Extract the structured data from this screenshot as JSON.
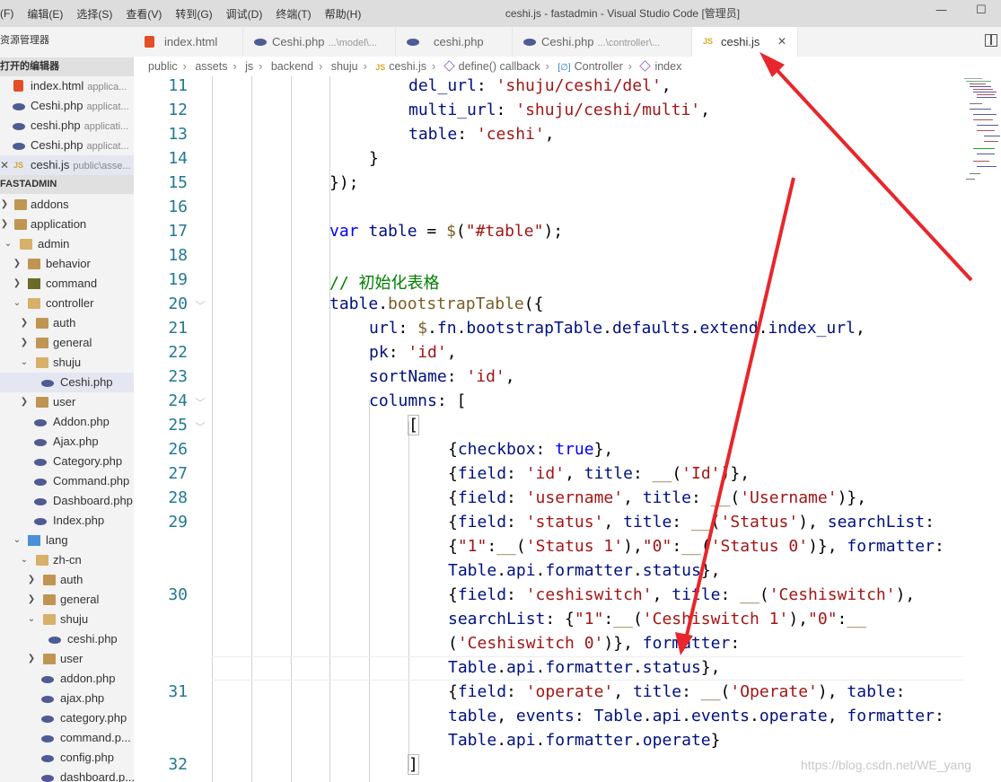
{
  "titlebar": {
    "menu": [
      "(F)",
      "编辑(E)",
      "选择(S)",
      "查看(V)",
      "转到(G)",
      "调试(D)",
      "终端(T)",
      "帮助(H)"
    ],
    "title": "ceshi.js - fastadmin - Visual Studio Code [管理员]"
  },
  "sidebar": {
    "header": "资源管理器",
    "open_editors_title": "打开的编辑器",
    "open_editors": [
      {
        "label": "index.html",
        "desc": "applica..."
      },
      {
        "label": "Ceshi.php",
        "desc": "applicat..."
      },
      {
        "label": "ceshi.php",
        "desc": "applicati..."
      },
      {
        "label": "Ceshi.php",
        "desc": "applicat..."
      },
      {
        "label": "ceshi.js",
        "desc": "public\\asse..."
      }
    ],
    "project_title": "FASTADMIN",
    "tree": [
      "addons",
      "application",
      "admin",
      "behavior",
      "command",
      "controller",
      "auth",
      "general",
      "shuju",
      "Ceshi.php",
      "user",
      "Addon.php",
      "Ajax.php",
      "Category.php",
      "Command.php",
      "Dashboard.php",
      "Index.php",
      "lang",
      "zh-cn",
      "auth",
      "general",
      "shuju",
      "ceshi.php",
      "user",
      "addon.php",
      "ajax.php",
      "category.php",
      "command.p...",
      "config.php",
      "dashboard.p..."
    ]
  },
  "tabs": [
    {
      "label": "index.html",
      "desc": ""
    },
    {
      "label": "Ceshi.php",
      "desc": "...\\model\\..."
    },
    {
      "label": "ceshi.php",
      "desc": ""
    },
    {
      "label": "Ceshi.php",
      "desc": "...\\controller\\..."
    },
    {
      "label": "ceshi.js",
      "desc": "",
      "close": "✕"
    }
  ],
  "breadcrumb": [
    "public",
    "assets",
    "js",
    "backend",
    "shuju",
    "ceshi.js",
    "define() callback",
    "Controller",
    "index"
  ],
  "line_numbers": [
    "11",
    "12",
    "13",
    "14",
    "15",
    "16",
    "17",
    "18",
    "19",
    "20",
    "21",
    "22",
    "23",
    "24",
    "25",
    "26",
    "27",
    "28",
    "29",
    "30",
    "31",
    "32"
  ],
  "code": {
    "l11": [
      "del_url",
      ": ",
      "'shuju/ceshi/del'",
      ","
    ],
    "l12": [
      "multi_url",
      ": ",
      "'shuju/ceshi/multi'",
      ","
    ],
    "l13": [
      "table",
      ": ",
      "'ceshi'",
      ","
    ],
    "l14": "}",
    "l15": "});",
    "l17": [
      "var",
      " ",
      "table",
      " = ",
      "$",
      "(",
      "\"#table\"",
      ");"
    ],
    "l19": "// 初始化表格",
    "l20": [
      "table",
      ".",
      "bootstrapTable",
      "({"
    ],
    "l21": [
      "url",
      ": ",
      "$",
      ".",
      "fn",
      ".",
      "bootstrapTable",
      ".",
      "defaults",
      ".",
      "extend",
      ".",
      "index_url",
      ","
    ],
    "l22": [
      "pk",
      ": ",
      "'id'",
      ","
    ],
    "l23": [
      "sortName",
      ": ",
      "'id'",
      ","
    ],
    "l24": [
      "columns",
      ": ["
    ],
    "l25": "[",
    "l26": [
      "{",
      "checkbox",
      ": ",
      "true",
      "},"
    ],
    "l27": [
      "{",
      "field",
      ": ",
      "'id'",
      ", ",
      "title",
      ": ",
      "__",
      "(",
      "'Id'",
      ")},"
    ],
    "l28": [
      "{",
      "field",
      ": ",
      "'username'",
      ", ",
      "title",
      ": ",
      "__",
      "(",
      "'Username'",
      ")},"
    ],
    "l29a": [
      "{",
      "field",
      ": ",
      "'status'",
      ", ",
      "title",
      ": ",
      "__",
      "(",
      "'Status'",
      "), ",
      "searchList",
      ":"
    ],
    "l29b": [
      "{",
      "\"1\"",
      ":",
      "__",
      "(",
      "'Status 1'",
      "),",
      "\"0\"",
      ":",
      "__",
      "(",
      "'Status 0'",
      ")}, ",
      "formatter",
      ":"
    ],
    "l29c": [
      "Table",
      ".",
      "api",
      ".",
      "formatter",
      ".",
      "status",
      "},"
    ],
    "l30a": [
      "{",
      "field",
      ": ",
      "'ceshiswitch'",
      ", ",
      "title",
      ": ",
      "__",
      "(",
      "'Ceshiswitch'",
      "),"
    ],
    "l30b": [
      "searchList",
      ": {",
      "\"1\"",
      ":",
      "__",
      "(",
      "'Ceshiswitch 1'",
      "),",
      "\"0\"",
      ":",
      "__"
    ],
    "l30c": [
      "(",
      "'Ceshiswitch 0'",
      ")}, ",
      "formatter",
      ":"
    ],
    "l30d": [
      "Table",
      ".",
      "api",
      ".",
      "formatter",
      ".",
      "status",
      "},"
    ],
    "l31a": [
      "{",
      "field",
      ": ",
      "'operate'",
      ", ",
      "title",
      ": ",
      "__",
      "(",
      "'Operate'",
      "), ",
      "table",
      ":"
    ],
    "l31b": [
      "table",
      ", ",
      "events",
      ": ",
      "Table",
      ".",
      "api",
      ".",
      "events",
      ".",
      "operate",
      ", ",
      "formatter",
      ":"
    ],
    "l31c": [
      "Table",
      ".",
      "api",
      ".",
      "formatter",
      ".",
      "operate",
      "}"
    ],
    "l32": "]"
  },
  "watermark": "https://blog.csdn.net/WE_yang",
  "colors": {
    "keyword": "#0000ff",
    "string": "#a31515",
    "comment": "#008000",
    "property": "#001080",
    "function": "#795e26",
    "line_number": "#237893",
    "arrow": "#e8262b"
  }
}
